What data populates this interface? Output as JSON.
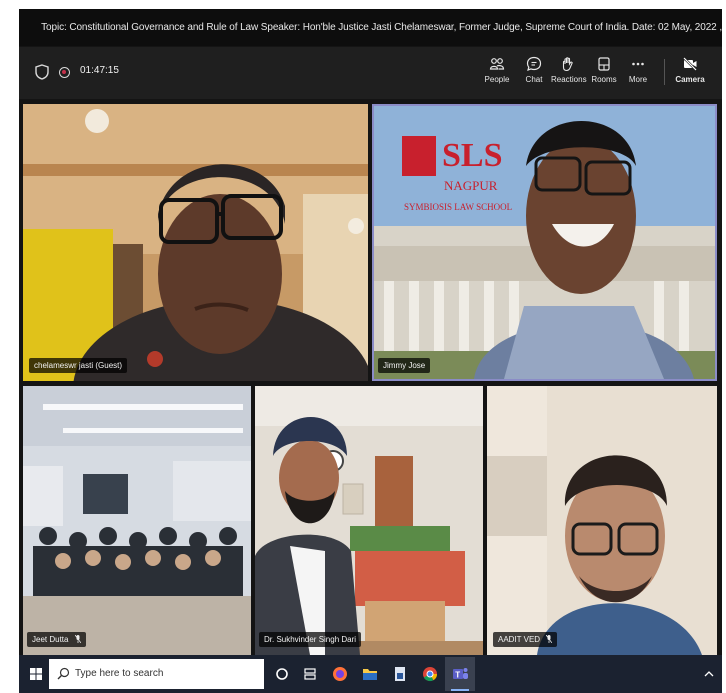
{
  "meeting": {
    "topic": "Topic: Constitutional Governance and Rule of Law Speaker: Hon'ble Justice Jasti Chelameswar, Former Judge, Supreme Court of India. Date: 02 May, 2022 ,",
    "elapsed_time": "01:47:15"
  },
  "toolbar": {
    "people_label": "People",
    "chat_label": "Chat",
    "reactions_label": "Reactions",
    "rooms_label": "Rooms",
    "more_label": "More",
    "camera_label": "Camera"
  },
  "participants": [
    {
      "name": "chelameswr jasti (Guest)",
      "muted": false
    },
    {
      "name": "Jimmy Jose",
      "muted": false,
      "active_speaker": true
    },
    {
      "name": "Jeet Dutta",
      "muted": true
    },
    {
      "name": "Dr. Sukhvinder Singh Dari",
      "muted": false
    },
    {
      "name": "AADIT VED",
      "muted": true
    }
  ],
  "background": {
    "brand": "SLS",
    "city": "NAGPUR",
    "school": "SYMBIOSIS LAW SCHOOL"
  },
  "taskbar": {
    "search_placeholder": "Type here to search"
  },
  "colors": {
    "active_border": "#8b8cc7",
    "sls_red": "#c8202d",
    "teams_purple": "#5b5fc7"
  }
}
